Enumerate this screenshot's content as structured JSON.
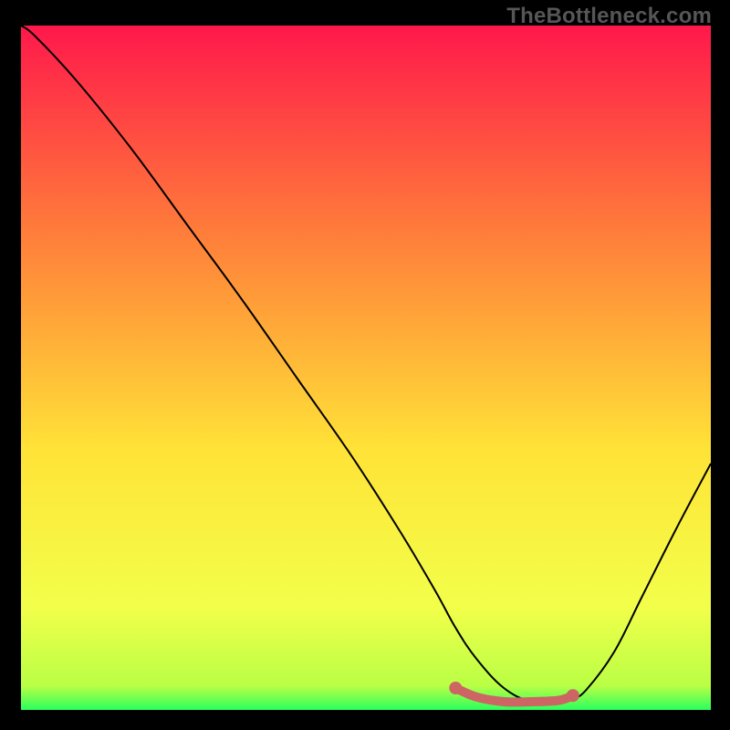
{
  "watermark": "TheBottleneck.com",
  "colors": {
    "bg": "#000000",
    "grad_top": "#ff184b",
    "grad_mid1": "#ff7c3a",
    "grad_mid2": "#ffe337",
    "grad_mid3": "#f2ff4a",
    "grad_bot": "#2bff5d",
    "curve": "#000000",
    "accent": "#cc6563"
  },
  "chart_data": {
    "type": "line",
    "title": "",
    "xlabel": "",
    "ylabel": "",
    "xlim": [
      0,
      100
    ],
    "ylim": [
      0,
      100
    ],
    "series": [
      {
        "name": "curve",
        "x": [
          0,
          2,
          8,
          16,
          24,
          32,
          40,
          48,
          55,
          60,
          63,
          66,
          70,
          74,
          78,
          80,
          82,
          86,
          90,
          95,
          100
        ],
        "y": [
          100,
          98.5,
          92,
          82,
          71,
          60,
          48.5,
          37,
          26,
          17.5,
          12,
          7.5,
          3.2,
          1.2,
          1.2,
          1.6,
          3.0,
          8.5,
          16.5,
          26.5,
          36
        ]
      }
    ],
    "accent_segment": {
      "name": "flat-bottom",
      "x": [
        63,
        66,
        70,
        74,
        78,
        80
      ],
      "y": [
        3.2,
        1.9,
        1.2,
        1.2,
        1.4,
        2.1
      ]
    },
    "accent_endpoints": [
      {
        "x": 63,
        "y": 3.2
      },
      {
        "x": 80,
        "y": 2.1
      }
    ]
  }
}
